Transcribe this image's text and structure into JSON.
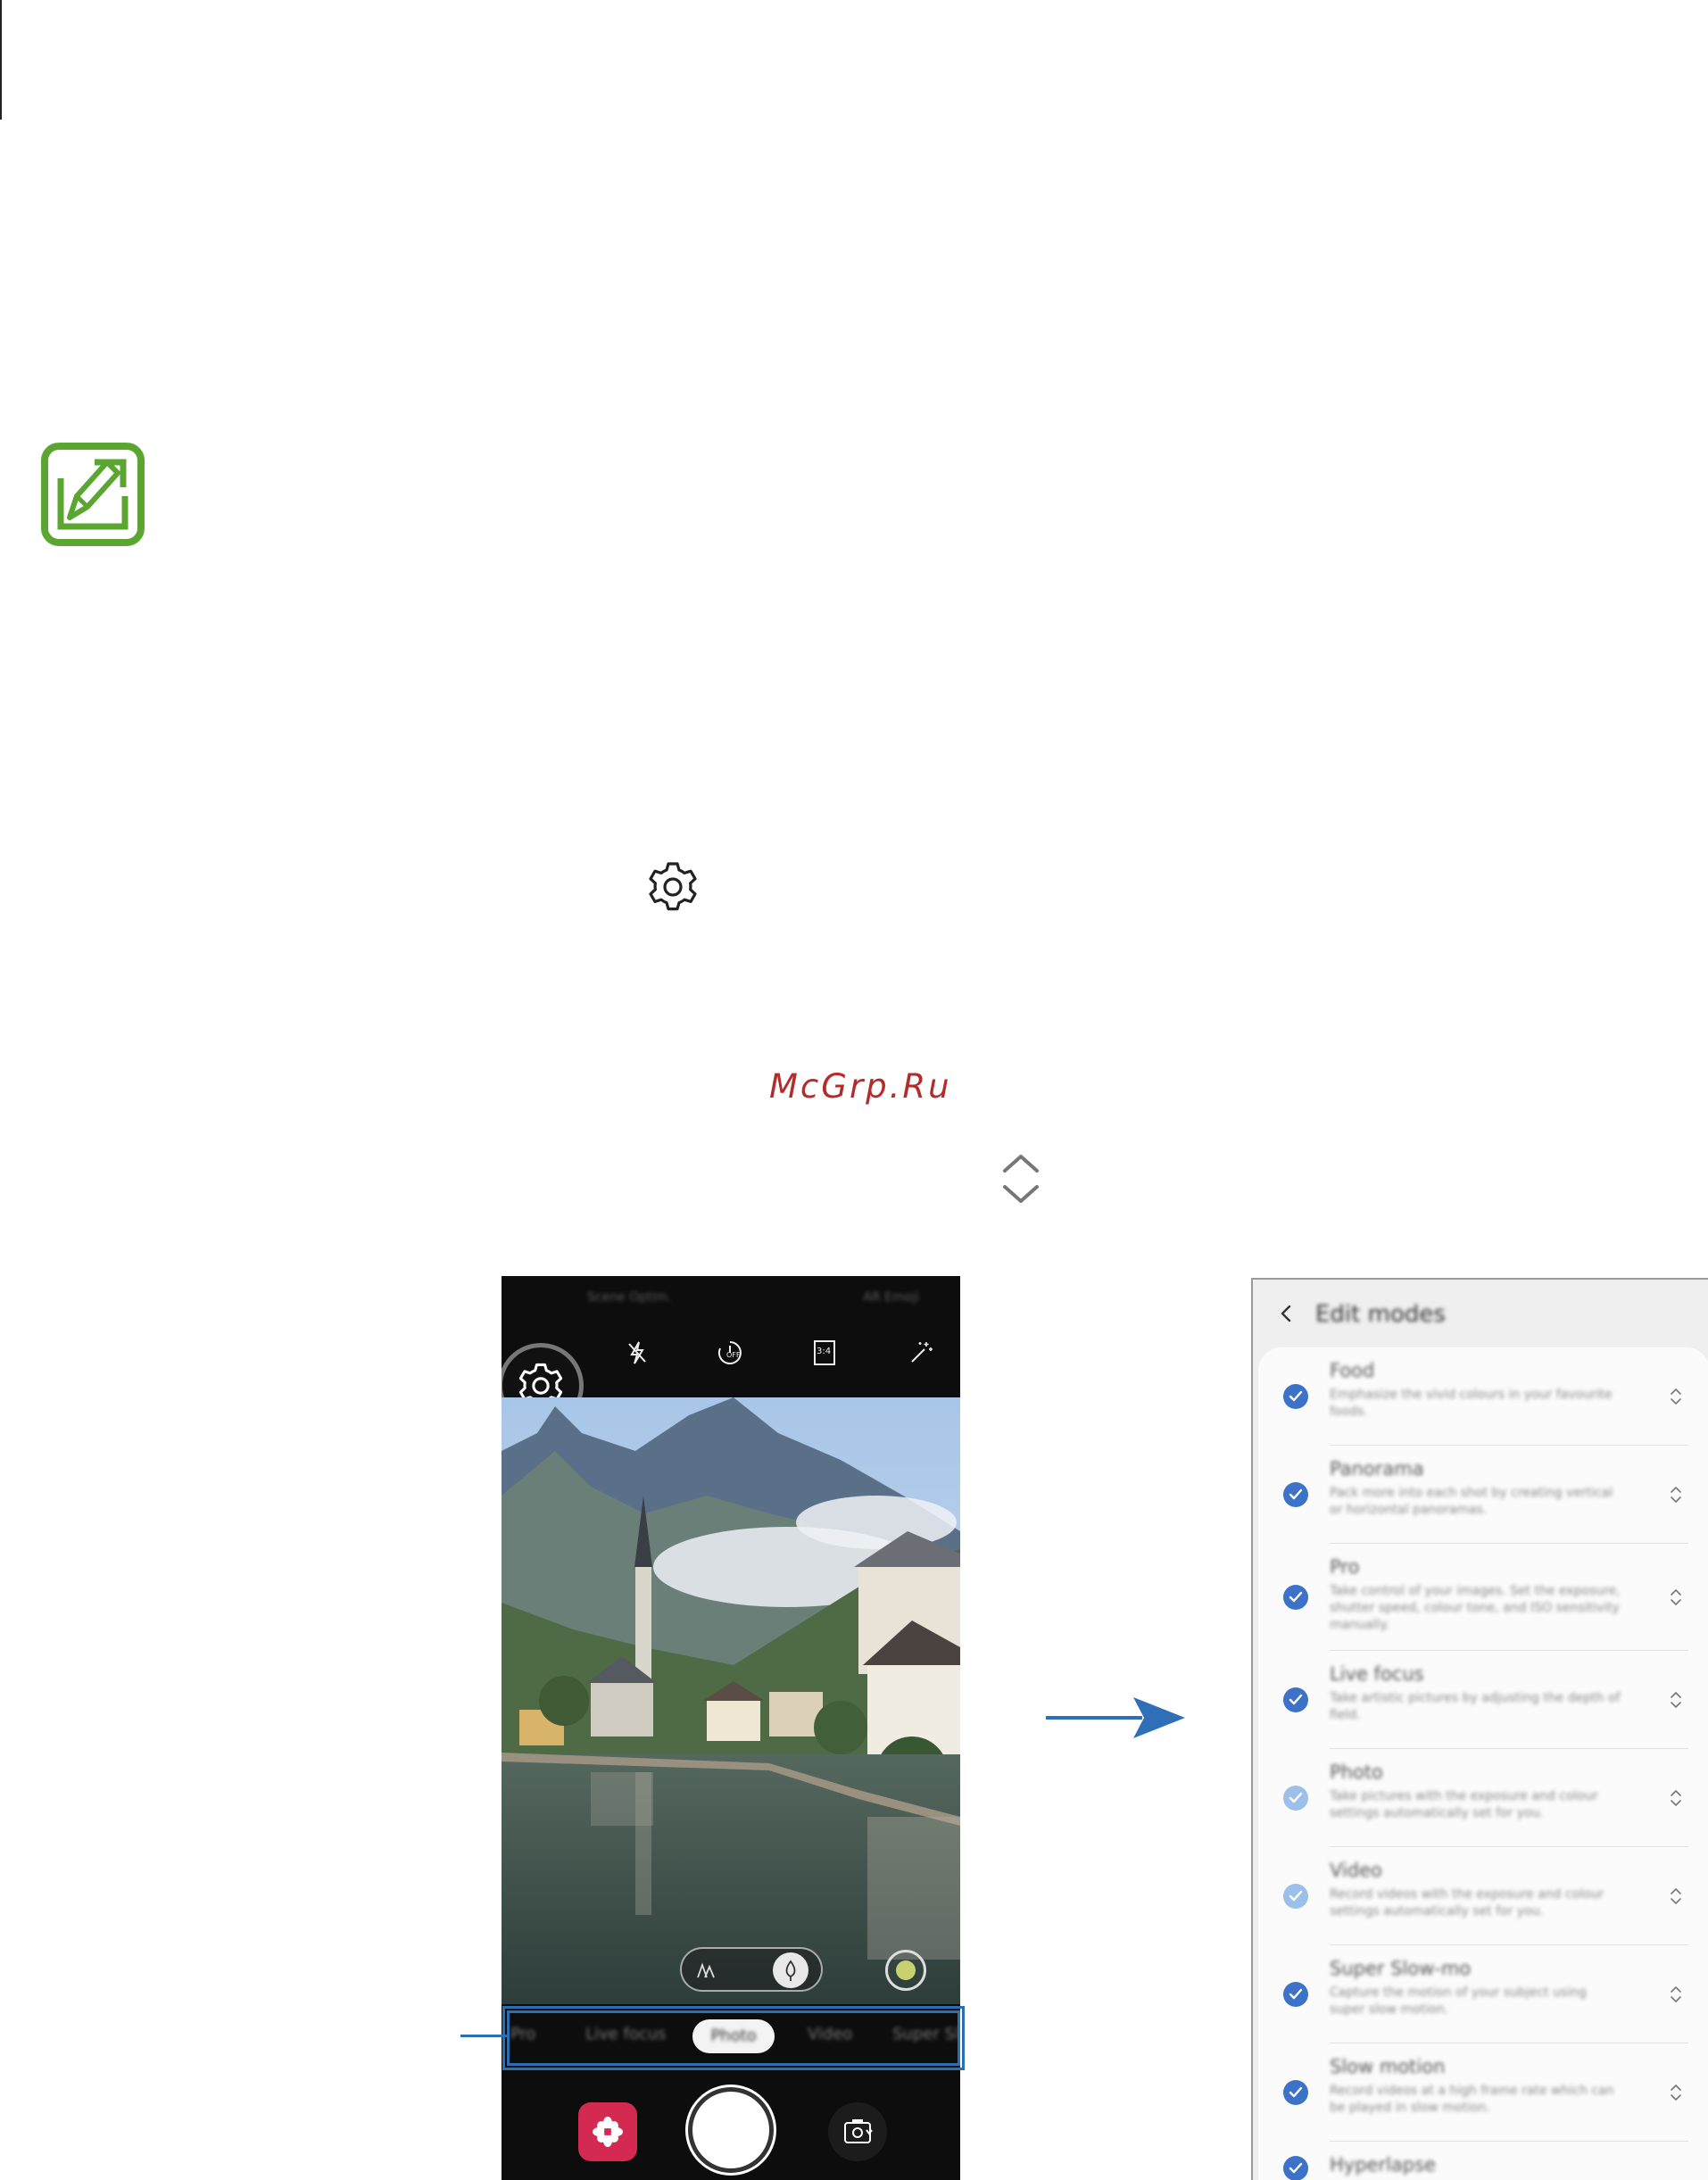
{
  "watermark": "McGrp.Ru",
  "camera": {
    "status_left": "Scene Optim.",
    "status_right": "AR Emoji",
    "timer_label": "OFF",
    "ratio_label": "3:4",
    "modes": [
      "Pro",
      "Live focus",
      "Photo",
      "Video",
      "Super Sl"
    ],
    "selected_mode": "Photo"
  },
  "edit_modes": {
    "title": "Edit modes",
    "rows": [
      {
        "title": "Food",
        "desc": "Emphasize the vivid colours in your favourite foods.",
        "check": "dark"
      },
      {
        "title": "Panorama",
        "desc": "Pack more into each shot by creating vertical or horizontal panoramas.",
        "check": "dark"
      },
      {
        "title": "Pro",
        "desc": "Take control of your images. Set the exposure, shutter speed, colour tone, and ISO sensitivity manually.",
        "check": "dark"
      },
      {
        "title": "Live focus",
        "desc": "Take artistic pictures by adjusting the depth of field.",
        "check": "dark"
      },
      {
        "title": "Photo",
        "desc": "Take pictures with the exposure and colour settings automatically set for you.",
        "check": "light"
      },
      {
        "title": "Video",
        "desc": "Record videos with the exposure and colour settings automatically set for you.",
        "check": "light"
      },
      {
        "title": "Super Slow-mo",
        "desc": "Capture the motion of your subject using super slow motion.",
        "check": "dark"
      },
      {
        "title": "Slow motion",
        "desc": "Record videos at a high frame rate which can be played in slow motion.",
        "check": "dark"
      },
      {
        "title": "Hyperlapse",
        "desc": "",
        "check": "dark"
      }
    ]
  },
  "colors": {
    "note_green": "#5aa631",
    "callout_blue": "#2a6fb3",
    "check_blue": "#3c73c8",
    "gallery_red": "#d42a51",
    "watermark_red": "#b52a2a"
  }
}
